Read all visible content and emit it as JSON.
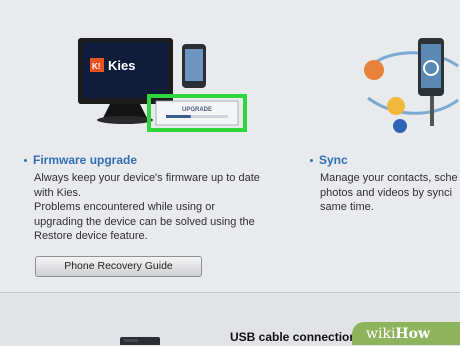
{
  "hero": {
    "app_logo_text": "Kies",
    "upgrade_label": "UPGRADE",
    "upgrade_progress": 0.4
  },
  "features": {
    "firmware": {
      "title": "Firmware upgrade",
      "description": "Always keep your device's firmware up to date\nwith Kies.\nProblems encountered while using or\nupgrading the device can be solved using the\nRestore device feature.",
      "button_label": "Phone Recovery Guide"
    },
    "sync": {
      "title": "Sync",
      "description": "Manage your contacts, sche\nphotos and videos by synci\nsame time."
    }
  },
  "bottom": {
    "usb_title": "USB cable connection"
  },
  "watermark": {
    "wiki": "wiki",
    "how": "How"
  },
  "colors": {
    "highlight": "#2fd63a",
    "accent_title": "#2f6fb3",
    "wikihow_green": "#8db35c"
  }
}
